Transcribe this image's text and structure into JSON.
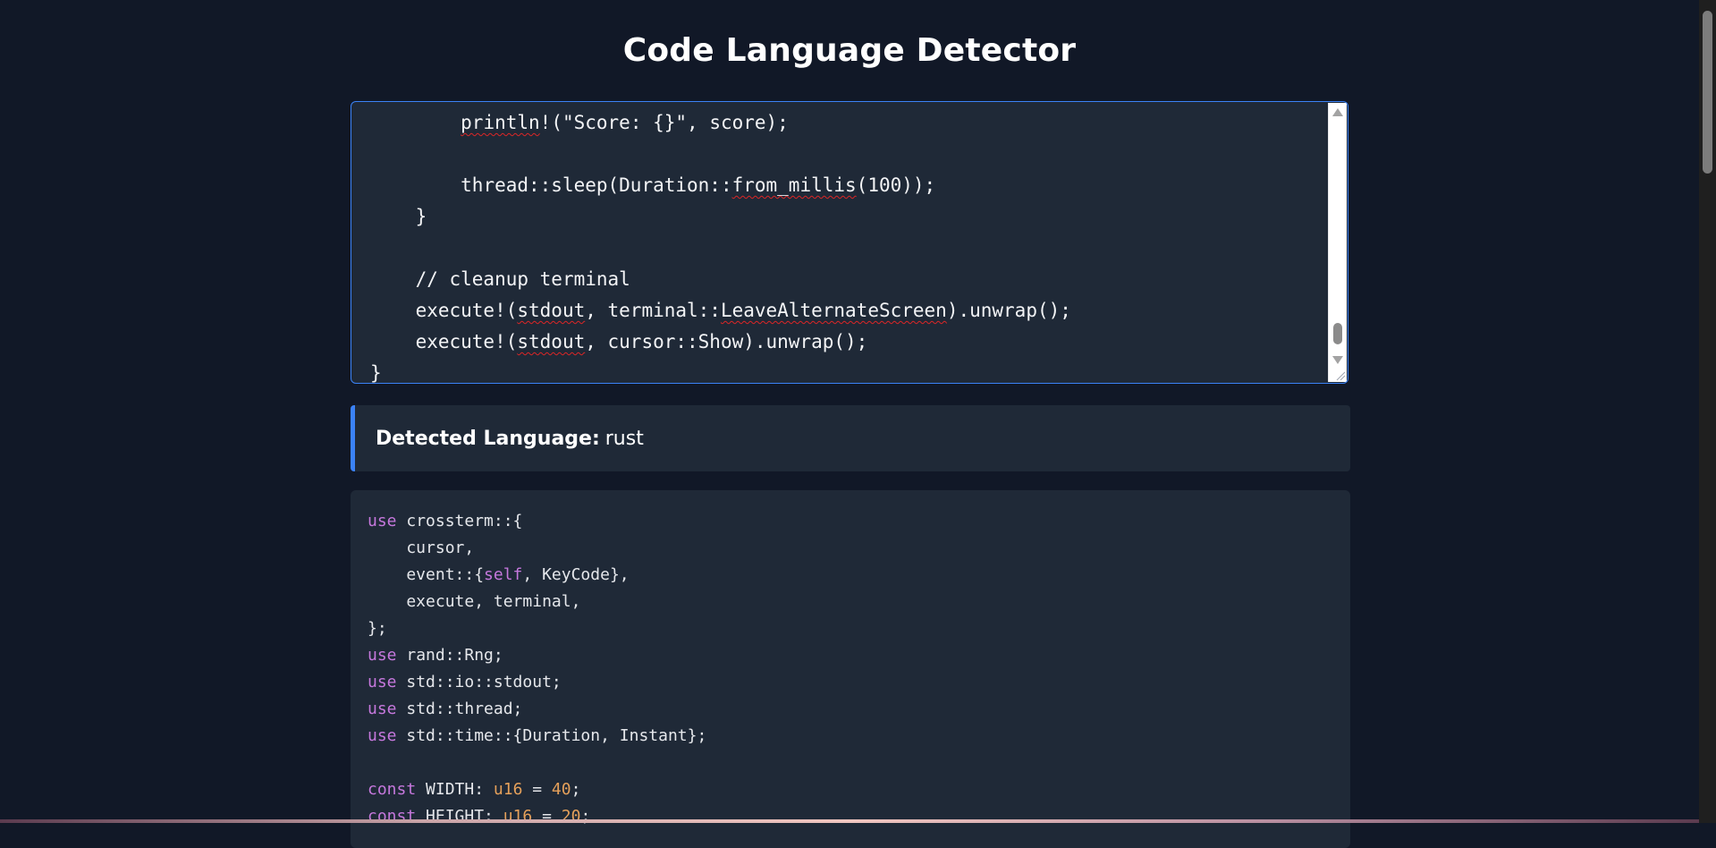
{
  "page": {
    "title": "Code Language Detector"
  },
  "editor": {
    "lines": [
      {
        "indent": "        ",
        "segments": [
          {
            "t": "println",
            "sq": true
          },
          {
            "t": "!(\"Score: {}\", score);"
          }
        ]
      },
      {
        "indent": "",
        "segments": []
      },
      {
        "indent": "        ",
        "segments": [
          {
            "t": "thread::sleep(Duration::"
          },
          {
            "t": "from_millis",
            "sq": true
          },
          {
            "t": "(100));"
          }
        ]
      },
      {
        "indent": "    ",
        "segments": [
          {
            "t": "}"
          }
        ]
      },
      {
        "indent": "",
        "segments": []
      },
      {
        "indent": "    ",
        "segments": [
          {
            "t": "// cleanup terminal"
          }
        ]
      },
      {
        "indent": "    ",
        "segments": [
          {
            "t": "execute!("
          },
          {
            "t": "stdout",
            "sq": true
          },
          {
            "t": ", terminal::"
          },
          {
            "t": "LeaveAlternateScreen",
            "sq": true
          },
          {
            "t": ").unwrap();"
          }
        ]
      },
      {
        "indent": "    ",
        "segments": [
          {
            "t": "execute!("
          },
          {
            "t": "stdout",
            "sq": true
          },
          {
            "t": ", cursor::Show).unwrap();"
          }
        ]
      },
      {
        "indent": "",
        "segments": [
          {
            "t": "}"
          }
        ]
      }
    ]
  },
  "result": {
    "label": "Detected Language:",
    "value": "rust"
  },
  "code_output": {
    "lines": [
      [
        {
          "t": "use",
          "c": "kw"
        },
        {
          "t": " crossterm::{"
        }
      ],
      [
        {
          "t": "    cursor,"
        }
      ],
      [
        {
          "t": "    event::{"
        },
        {
          "t": "self",
          "c": "kw"
        },
        {
          "t": ", KeyCode},"
        }
      ],
      [
        {
          "t": "    execute, terminal,"
        }
      ],
      [
        {
          "t": "};"
        }
      ],
      [
        {
          "t": "use",
          "c": "kw"
        },
        {
          "t": " rand::Rng;"
        }
      ],
      [
        {
          "t": "use",
          "c": "kw"
        },
        {
          "t": " std::io::stdout;"
        }
      ],
      [
        {
          "t": "use",
          "c": "kw"
        },
        {
          "t": " std::thread;"
        }
      ],
      [
        {
          "t": "use",
          "c": "kw"
        },
        {
          "t": " std::time::{Duration, Instant};"
        }
      ],
      [],
      [
        {
          "t": "const",
          "c": "kw"
        },
        {
          "t": " WIDTH: "
        },
        {
          "t": "u16",
          "c": "ty"
        },
        {
          "t": " = "
        },
        {
          "t": "40",
          "c": "num"
        },
        {
          "t": ";"
        }
      ],
      [
        {
          "t": "const",
          "c": "kw"
        },
        {
          "t": " HEIGHT: "
        },
        {
          "t": "u16",
          "c": "ty"
        },
        {
          "t": " = "
        },
        {
          "t": "20",
          "c": "num"
        },
        {
          "t": ";"
        }
      ]
    ]
  },
  "colors": {
    "background": "#111827",
    "panel": "#1f2937",
    "accent": "#3b82f6",
    "keyword": "#c678dd",
    "type_number": "#e5a05a"
  }
}
